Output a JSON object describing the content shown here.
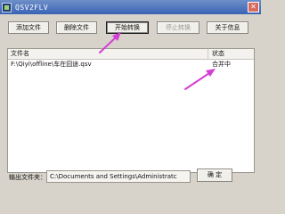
{
  "window": {
    "title": "QSV2FLV",
    "close_glyph": "✕"
  },
  "toolbar": {
    "add_label": "添加文件",
    "delete_label": "删除文件",
    "start_label": "开始转换",
    "stop_label": "停止转换",
    "about_label": "关于信息"
  },
  "list": {
    "columns": {
      "file": "文件名",
      "status": "状态"
    },
    "rows": [
      {
        "file": "F:\\Qiyi\\offline\\车在囧途.qsv",
        "status": "合并中"
      }
    ]
  },
  "footer": {
    "output_label": "输出文件夹：",
    "output_path": "C:\\Documents and Settings\\Administratc",
    "ok_label": "确 定"
  },
  "colors": {
    "titlebar": "#3a63b4",
    "annotation_arrow": "#d43fd4"
  },
  "icons": [
    "app-icon",
    "close-icon"
  ]
}
